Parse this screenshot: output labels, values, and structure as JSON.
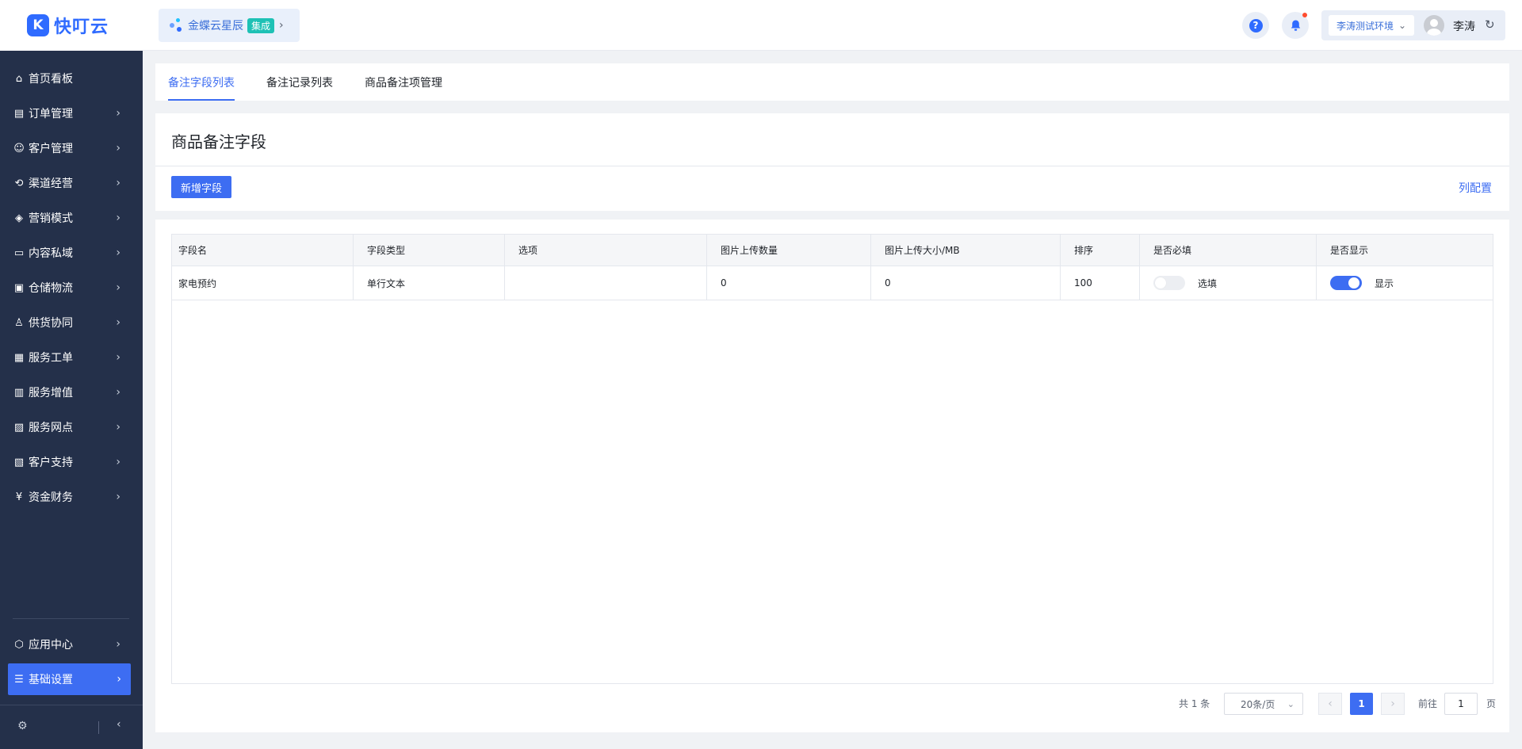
{
  "brand": {
    "logo_letter": "K",
    "name": "快叮云"
  },
  "app_switch": {
    "name": "金蝶云星辰",
    "badge": "集成"
  },
  "header": {
    "help_icon": "?",
    "environment": "李涛测试环境",
    "user_name": "李涛"
  },
  "sidebar": {
    "items": [
      {
        "label": "首页看板",
        "icon": "⌂"
      },
      {
        "label": "订单管理",
        "icon": "▤"
      },
      {
        "label": "客户管理",
        "icon": "☺"
      },
      {
        "label": "渠道经营",
        "icon": "⟲"
      },
      {
        "label": "营销模式",
        "icon": "◈"
      },
      {
        "label": "内容私域",
        "icon": "▭"
      },
      {
        "label": "仓储物流",
        "icon": "▣"
      },
      {
        "label": "供货协同",
        "icon": "♙"
      },
      {
        "label": "服务工单",
        "icon": "▦"
      },
      {
        "label": "服务增值",
        "icon": "▥"
      },
      {
        "label": "服务网点",
        "icon": "▨"
      },
      {
        "label": "客户支持",
        "icon": "▧"
      },
      {
        "label": "资金财务",
        "icon": "¥"
      }
    ],
    "bottom_items": [
      {
        "label": "应用中心",
        "icon": "⬡"
      },
      {
        "label": "基础设置",
        "icon": "☰"
      }
    ]
  },
  "tabs": [
    {
      "label": "备注字段列表",
      "active": true
    },
    {
      "label": "备注记录列表",
      "active": false
    },
    {
      "label": "商品备注项管理",
      "active": false
    }
  ],
  "page": {
    "title": "商品备注字段",
    "add_button": "新增字段",
    "column_config": "列配置"
  },
  "table": {
    "columns": [
      "字段名",
      "字段类型",
      "选项",
      "图片上传数量",
      "图片上传大小/MB",
      "排序",
      "是否必填",
      "是否显示"
    ],
    "rows": [
      {
        "field_name": "家电预约",
        "field_type": "单行文本",
        "options": "",
        "image_count": "0",
        "image_size": "0",
        "sort": "100",
        "required_on": false,
        "required_label": "选填",
        "visible_on": true,
        "visible_label": "显示"
      }
    ]
  },
  "pagination": {
    "total": "共 1 条",
    "page_size": "20条/页",
    "current_page": "1",
    "goto_label": "前往",
    "goto_value": "1",
    "goto_unit": "页"
  },
  "colors": {
    "primary": "#3d6df2",
    "sidebar_bg": "#24304a",
    "badge": "#1ec1b5",
    "notice_dot": "#ff4d2f"
  }
}
